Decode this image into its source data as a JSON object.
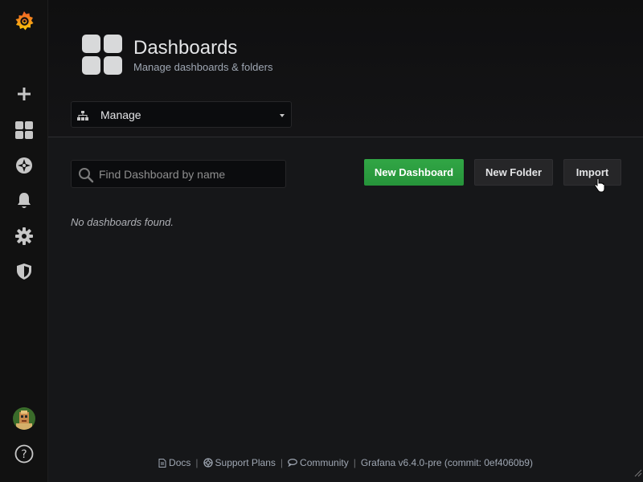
{
  "sidebar": {
    "logo_icon": "grafana-logo-icon",
    "items": [
      {
        "name": "create",
        "icon": "plus-icon"
      },
      {
        "name": "dashboards",
        "icon": "apps-grid-icon"
      },
      {
        "name": "explore",
        "icon": "compass-icon"
      },
      {
        "name": "alerting",
        "icon": "bell-icon"
      },
      {
        "name": "configuration",
        "icon": "gear-icon"
      },
      {
        "name": "server-admin",
        "icon": "shield-icon"
      }
    ],
    "bottom": [
      {
        "name": "profile",
        "icon": "avatar-icon"
      },
      {
        "name": "help",
        "icon": "question-circle-icon"
      }
    ]
  },
  "header": {
    "title": "Dashboards",
    "subtitle": "Manage dashboards & folders",
    "nav_select": "Manage"
  },
  "main": {
    "search_placeholder": "Find Dashboard by name",
    "new_dashboard_label": "New Dashboard",
    "new_folder_label": "New Folder",
    "import_label": "Import",
    "empty_message": "No dashboards found."
  },
  "footer": {
    "docs": "Docs",
    "support": "Support Plans",
    "community": "Community",
    "version": "Grafana v6.4.0-pre (commit: 0ef4060b9)",
    "separator": "|"
  },
  "colors": {
    "background": "#161719",
    "sidebar": "#111111",
    "success": "#299c46",
    "brand_orange": "#f05a28"
  }
}
